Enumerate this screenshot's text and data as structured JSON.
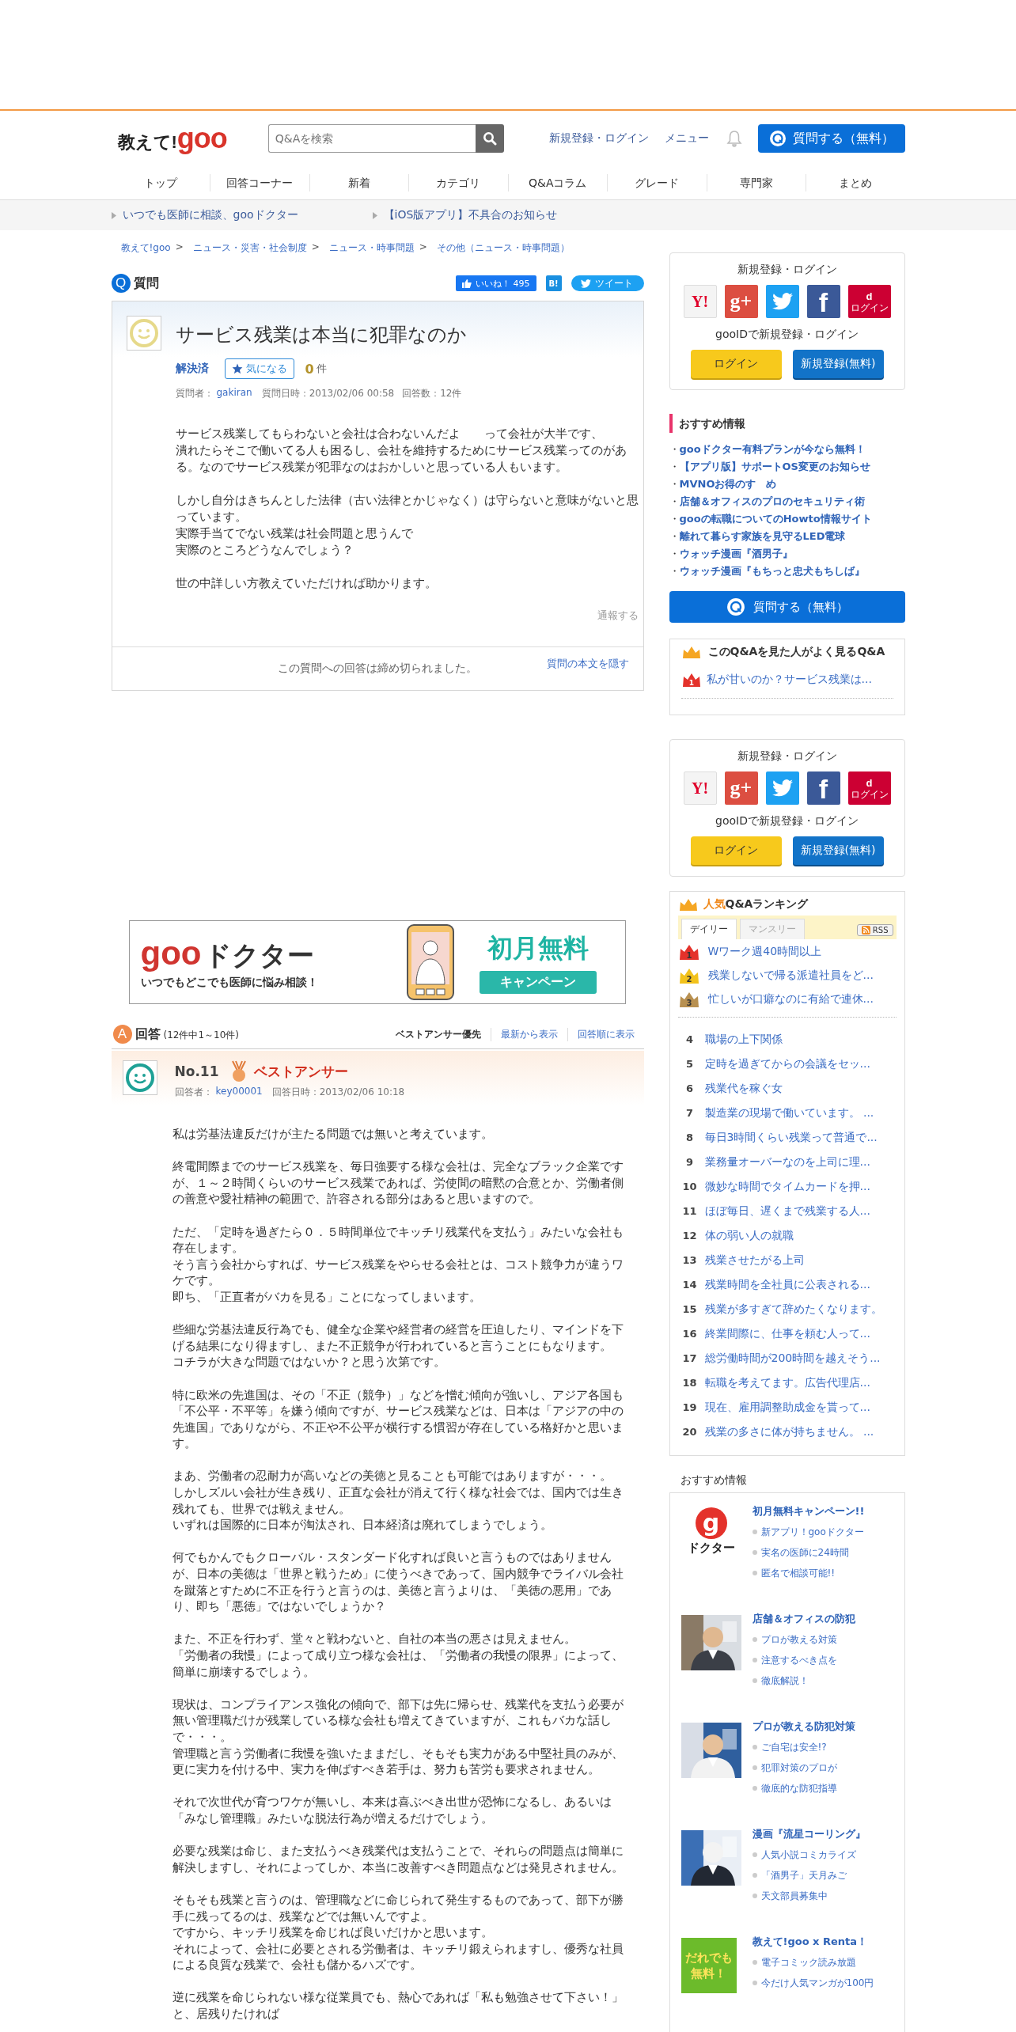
{
  "header": {
    "logo": {
      "text": "教えて!",
      "brand": "goo"
    },
    "search": {
      "placeholder": "Q&Aを検索"
    },
    "links": [
      "新規登録・ログイン",
      "メニュー"
    ],
    "ask_button": "質問する（無料）"
  },
  "nav": [
    "トップ",
    "回答コーナー",
    "新着",
    "カテゴリ",
    "Q&Aコラム",
    "グレード",
    "専門家",
    "まとめ"
  ],
  "notices": [
    "いつでも医師に相談、gooドクター",
    "【iOS版アプリ】不具合のお知らせ"
  ],
  "breadcrumb": [
    {
      "label": "教えて!goo",
      "sep": ">"
    },
    {
      "label": "ニュース・災害・社会制度",
      "sep": ">"
    },
    {
      "label": "ニュース・時事問題",
      "sep": ">"
    },
    {
      "label": "その他（ニュース・時事問題）"
    }
  ],
  "question": {
    "mark": "Q",
    "heading": "質問",
    "like": {
      "label": "いいね！",
      "count": "495"
    },
    "bookmark": "B!",
    "tweet": "ツイート",
    "title": "サービス残業は本当に犯罪なのか",
    "status": "解決済",
    "watch_button": "気になる",
    "watch_count": "0",
    "watch_unit": "件",
    "meta": [
      {
        "label": "質問者：",
        "link": "gakiran"
      },
      {
        "label": "質問日時：2013/02/06 00:58"
      },
      {
        "label": "回答数：12件"
      }
    ],
    "body": [
      [
        "サービス残業してもらわないと会社は合わないんだよ　　って会社が大半です、",
        "潰れたらそこで働いてる人も困るし、会社を維持するためにサービス残業ってのがある。なのでサービス残業が犯罪なのはおかしいと思っている人もいます。"
      ],
      [
        "しかし自分はきちんとした法律（古い法律とかじゃなく）は守らないと意味がないと思っています。",
        "実際手当てでない残業は社会問題と思うんで",
        "実際のところどうなんでしょう？"
      ],
      [
        "世の中詳しい方教えていただければ助かります。"
      ]
    ],
    "report": "通報する",
    "closed_notice": "この質問への回答は締め切られました。",
    "hide_link": "質問の本文を隠す"
  },
  "ad_banner": {
    "brand": "goo",
    "title": "ドクター",
    "tagline": "いつでもどこでも医師に悩み相談！",
    "offer": "初月無料",
    "ribbon": "キャンペーン"
  },
  "answers": {
    "mark": "A",
    "heading": "回答",
    "count": "(12件中1～10件)",
    "sort": [
      {
        "label": "ベストアンサー優先",
        "selected": true
      },
      {
        "label": "最新から表示",
        "selected": false
      },
      {
        "label": "回答順に表示",
        "selected": false
      }
    ],
    "items": [
      {
        "number": "No.11",
        "best_label": "ベストアンサー",
        "meta": [
          {
            "label": "回答者：",
            "link": "key00001"
          },
          {
            "label": "回答日時：2013/02/06 10:18"
          }
        ],
        "body": [
          [
            "私は労基法違反だけが主たる問題では無いと考えています。"
          ],
          [
            "終電間際までのサービス残業を、毎日強要する様な会社は、完全なブラック企業ですが、１～２時間くらいのサービス残業であれば、労使間の暗黙の合意とか、労働者側の善意や愛社精神の範囲で、許容される部分はあると思いますので。"
          ],
          [
            "ただ、「定時を過ぎたら０．５時間単位でキッチリ残業代を支払う」みたいな会社も存在します。",
            "そう言う会社からすれば、サービス残業をやらせる会社とは、コスト競争力が違うワケです。",
            "即ち、「正直者がバカを見る」ことになってしまいます。"
          ],
          [
            "些細な労基法違反行為でも、健全な企業や経営者の経営を圧迫したり、マインドを下げる結果になり得ますし、また不正競争が行われていると言うことにもなります。",
            "コチラが大きな問題ではないか？と思う次第です。"
          ],
          [
            "特に欧米の先進国は、その「不正（競争）」などを憎む傾向が強いし、アジア各国も「不公平・不平等」を嫌う傾向ですが、サービス残業などは、日本は「アジアの中の先進国」でありながら、不正や不公平が横行する慣習が存在している格好かと思います。"
          ],
          [
            "まあ、労働者の忍耐力が高いなどの美徳と見ることも可能ではありますが・・・。",
            "しかしズルい会社が生き残り、正直な会社が消えて行く様な社会では、国内では生き残れても、世界では戦えません。",
            "いずれは国際的に日本が淘汰され、日本経済は廃れてしまうでしょう。"
          ],
          [
            "何でもかんでもクローバル・スタンダード化すれば良いと言うものではありませんが、日本の美徳は「世界と戦うため」に使うべきであって、国内競争でライバル会社を蹴落とすために不正を行うと言うのは、美徳と言うよりは、「美徳の悪用」であり、即ち「悪徳」ではないでしょうか？"
          ],
          [
            "また、不正を行わず、堂々と戦わないと、自社の本当の悪さは見えません。",
            "「労働者の我慢」によって成り立つ様な会社は、「労働者の我慢の限界」によって、簡単に崩壊するでしょう。"
          ],
          [
            "現状は、コンプライアンス強化の傾向で、部下は先に帰らせ、残業代を支払う必要が無い管理職だけが残業している様な会社も増えてきていますが、これもバカな話しで・・・。",
            "管理職と言う労働者に我慢を強いたままだし、そもそも実力がある中堅社員のみが、更に実力を付ける中、実力を伸ばすべき若手は、努力も苦労も要求されません。"
          ],
          [
            "それで次世代が育つワケが無いし、本来は喜ぶべき出世が恐怖になるし、あるいは「みなし管理職」みたいな脱法行為が増えるだけでしょう。"
          ],
          [
            "必要な残業は命じ、また支払うべき残業代は支払うことで、それらの問題点は簡単に解決しますし、それによってしか、本当に改善すべき問題点などは発見されません。"
          ],
          [
            "そもそも残業と言うのは、管理職などに命じられて発生するものであって、部下が勝手に残ってるのは、残業などでは無いんですよ。",
            "ですから、キッチリ残業を命じれば良いだけかと思います。",
            "それによって、会社に必要とされる労働者は、キッチリ鍛えられますし、優秀な社員による良質な残業で、会社も儲かるハズです。"
          ],
          [
            "逆に残業を命じられない様な従業員でも、熱心であれば「私も勉強させて下さい！」と、居残りたければ"
          ]
        ]
      }
    ]
  },
  "sidebar": {
    "login_boxes": [
      {
        "title": "新規登録・ログイン",
        "providers": [
          {
            "kind": "yahoo",
            "mark": "Y!"
          },
          {
            "kind": "google",
            "mark": "g+"
          },
          {
            "kind": "twitter"
          },
          {
            "kind": "facebook",
            "mark": "f"
          },
          {
            "kind": "docomo",
            "mark": "d",
            "caption": "ログイン"
          }
        ],
        "goo_label": "gooIDで新規登録・ログイン",
        "login": "ログイン",
        "register": "新規登録(無料)"
      },
      {
        "title": "新規登録・ログイン",
        "providers": [
          {
            "kind": "yahoo",
            "mark": "Y!"
          },
          {
            "kind": "google",
            "mark": "g+"
          },
          {
            "kind": "twitter"
          },
          {
            "kind": "facebook",
            "mark": "f"
          },
          {
            "kind": "docomo",
            "mark": "d",
            "caption": "ログイン"
          }
        ],
        "goo_label": "gooIDで新規登録・ログイン",
        "login": "ログイン",
        "register": "新規登録(無料)"
      }
    ],
    "recommend": {
      "title": "おすすめ情報",
      "items": [
        {
          "bullet": "・",
          "label": "gooドクター有料プランが今なら無料！"
        },
        {
          "bullet": "・",
          "label": "【アプリ版】サポートOS変更のお知らせ"
        },
        {
          "bullet": "・",
          "label": "MVNOお得のす　め"
        },
        {
          "bullet": "・",
          "label": "店舗＆オフィスのプロのセキュリティ術"
        },
        {
          "bullet": "・",
          "label": "gooの転職についてのHowto情報サイト"
        },
        {
          "bullet": "・",
          "label": "離れて暮らす家族を見守るLED電球"
        },
        {
          "bullet": "・",
          "label": "ウォッチ漫画『酒男子』"
        },
        {
          "bullet": "・",
          "label": "ウォッチ漫画『もちっと忠犬もちしば』"
        }
      ]
    },
    "ask_button": "質問する（無料）",
    "related": {
      "title": "このQ&Aを見た人がよく見るQ&A",
      "items": [
        {
          "rank": "1",
          "label": "私が甘いのか？サービス残業は..."
        }
      ]
    },
    "ranking": {
      "title_accent": "人気",
      "title": "Q&Aランキング",
      "tabs": [
        {
          "label": "デイリー",
          "selected": true
        },
        {
          "label": "マンスリー",
          "selected": false
        }
      ],
      "rss": "RSS",
      "top": [
        {
          "rank": "1",
          "label": "Wワーク週40時間以上",
          "color": "#e4322b"
        },
        {
          "rank": "2",
          "label": "残業しないで帰る派遣社員をど...",
          "color": "#f2c21b"
        },
        {
          "rank": "3",
          "label": "忙しいが口癖なのに有給で連休...",
          "color": "#b89050"
        }
      ],
      "rest": [
        {
          "rank": "4",
          "label": "職場の上下関係"
        },
        {
          "rank": "5",
          "label": "定時を過ぎてからの会議をセッ..."
        },
        {
          "rank": "6",
          "label": "残業代を稼ぐ女"
        },
        {
          "rank": "7",
          "label": "製造業の現場で働いています。 ..."
        },
        {
          "rank": "8",
          "label": "毎日3時間くらい残業って普通で..."
        },
        {
          "rank": "9",
          "label": "業務量オーバーなのを上司に理..."
        },
        {
          "rank": "10",
          "label": "微妙な時間でタイムカードを押..."
        },
        {
          "rank": "11",
          "label": "ほぼ毎日、遅くまで残業する人..."
        },
        {
          "rank": "12",
          "label": "体の弱い人の就職"
        },
        {
          "rank": "13",
          "label": "残業させたがる上司"
        },
        {
          "rank": "14",
          "label": "残業時間を全社員に公表される..."
        },
        {
          "rank": "15",
          "label": "残業が多すぎて辞めたくなります。"
        },
        {
          "rank": "16",
          "label": "終業間際に、仕事を頼む人って..."
        },
        {
          "rank": "17",
          "label": "総労働時間が200時間を越えそう..."
        },
        {
          "rank": "18",
          "label": "転職を考えてます。広告代理店..."
        },
        {
          "rank": "19",
          "label": "現在、雇用調整助成金を貰って..."
        },
        {
          "rank": "20",
          "label": "残業の多さに体が持ちません。 ..."
        }
      ]
    },
    "features_title": "おすすめ情報",
    "features": [
      {
        "kind": "logo",
        "logo_mark": "g",
        "logo_text": "ドクター",
        "title": "初月無料キャンペーン!!",
        "links": [
          "新アプリ！gooドクター",
          "実名の医師に24時間",
          "匿名で相談可能!!"
        ]
      },
      {
        "kind": "picture",
        "title": "店舗＆オフィスの防犯",
        "links": [
          "プロが教える対策",
          "注意するべき点を",
          "徹底解説！"
        ]
      },
      {
        "kind": "picture",
        "title": "プロが教える防犯対策",
        "links": [
          "ご自宅は安全!?",
          "犯罪対策のプロが",
          "徹底的な防犯指導"
        ]
      },
      {
        "kind": "picture",
        "title": "漫画『流星コーリング』",
        "links": [
          "人気小説コミカライズ",
          "「酒男子」天月みご",
          "天文部員募集中"
        ]
      },
      {
        "kind": "badge",
        "badge_text": "だれでも無料！",
        "title": "教えて!goo x Renta！",
        "links": [
          "電子コミック読み放題",
          "今だけ人気マンガが100円"
        ]
      }
    ]
  }
}
